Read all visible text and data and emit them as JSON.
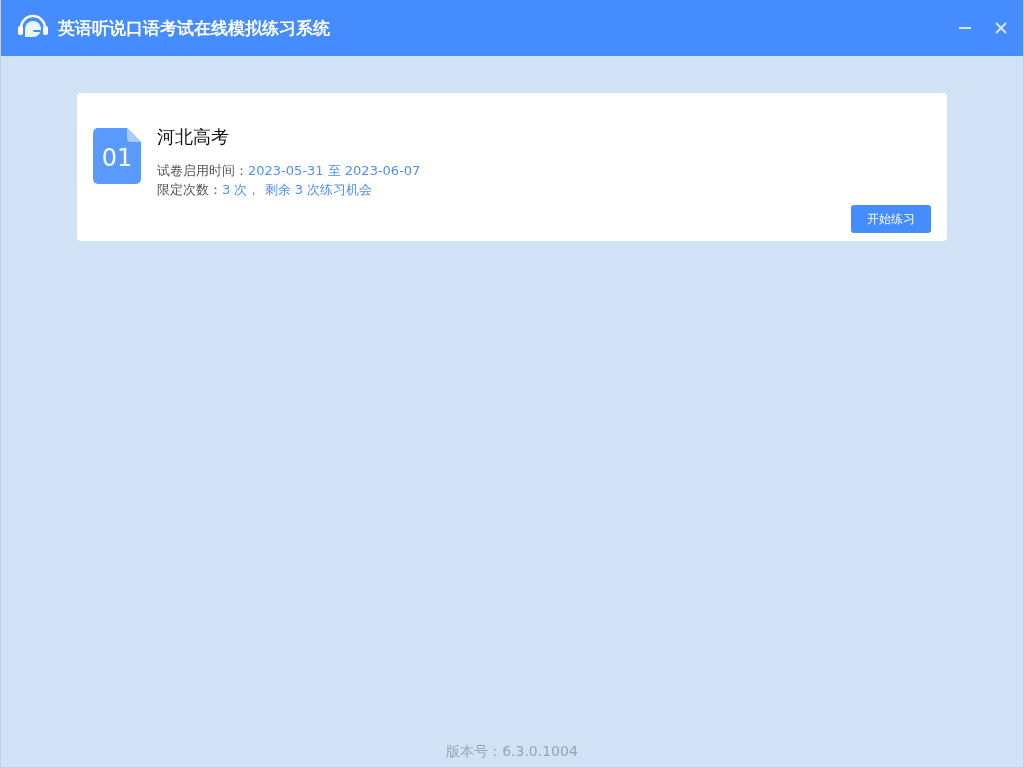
{
  "window": {
    "title": "英语听说口语考试在线模拟练习系统"
  },
  "exams": [
    {
      "number": "01",
      "name": "河北高考",
      "period_label": "试卷启用时间：",
      "period": "2023-05-31 至 2023-06-07",
      "limit_label": "限定次数：",
      "limit": "3 次， 剩余 3 次练习机会",
      "button": "开始练习"
    }
  ],
  "footer": {
    "version": "版本号：6.3.0.1004"
  }
}
